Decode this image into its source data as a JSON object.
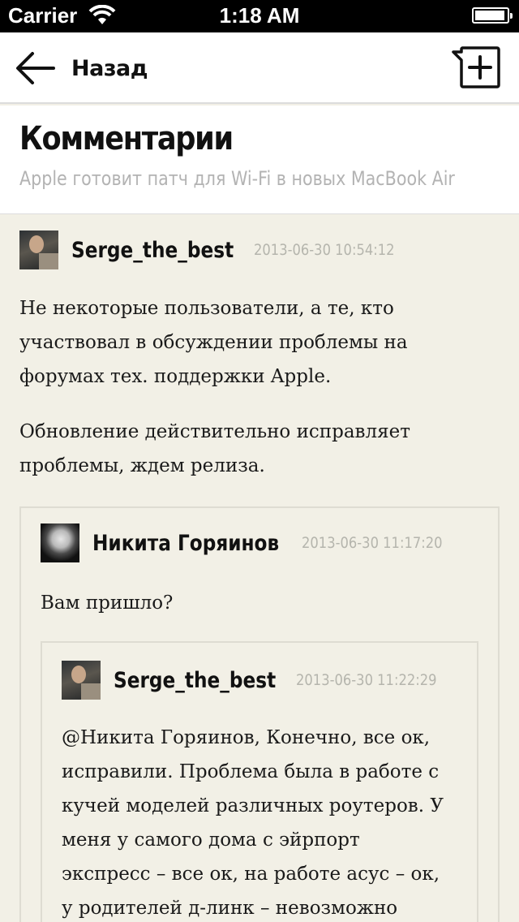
{
  "status_bar": {
    "carrier": "Carrier",
    "time": "1:18 AM"
  },
  "nav": {
    "back_label": "Назад",
    "back_icon": "arrow-left-icon",
    "add_icon": "add-comment-icon"
  },
  "header": {
    "title": "Комментарии",
    "article_title": "Apple готовит патч для Wi-Fi в новых MacBook Air"
  },
  "comments": [
    {
      "author": "Serge_the_best",
      "timestamp": "2013-06-30 10:54:12",
      "avatar": "user-photo",
      "paragraphs": [
        [
          "Не некоторые пользователи, а те, кто",
          "участвовал в обсуждении проблемы на",
          "форумах тех. поддержки Apple."
        ],
        [
          "Обновление действительно исправляет",
          "проблемы, ждем релиза."
        ]
      ],
      "replies": [
        {
          "author": "Никита Горяинов",
          "timestamp": "2013-06-30 11:17:20",
          "avatar": "user-photo",
          "paragraphs": [
            [
              "Вам пришло?"
            ]
          ],
          "replies": [
            {
              "author": "Serge_the_best",
              "timestamp": "2013-06-30 11:22:29",
              "avatar": "user-photo",
              "paragraphs": [
                [
                  "@Никита Горяинов, Конечно, все ок,",
                  "исправили. Проблема была в работе с",
                  "кучей моделей различных роутеров. У",
                  "меня у самого дома с эйрпорт",
                  "экспресс – все ок, на работе асус – ок,",
                  "у родителей д-линк – невозможно"
                ]
              ]
            }
          ]
        }
      ]
    }
  ]
}
